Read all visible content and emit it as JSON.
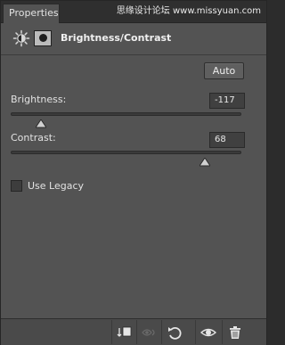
{
  "window": {
    "tab_label": "Properties",
    "watermark": "思缘设计论坛 www.missyuan.com"
  },
  "header": {
    "title": "Brightness/Contrast",
    "icons": [
      "brightness-contrast-icon",
      "layer-mask-icon"
    ]
  },
  "controls": {
    "auto_label": "Auto",
    "brightness": {
      "label": "Brightness:",
      "value": "-117",
      "slider_fraction": 0.13
    },
    "contrast": {
      "label": "Contrast:",
      "value": "68",
      "slider_fraction": 0.84
    },
    "use_legacy": {
      "label": "Use Legacy",
      "checked": false
    }
  },
  "toolbar": {
    "icons": [
      "clip-to-layer-icon",
      "view-previous-state-icon",
      "reset-icon",
      "visibility-eye-icon",
      "trash-icon"
    ]
  },
  "colors": {
    "panel": "#535353",
    "tab_bar": "#2f2f2f",
    "value_box": "#404040"
  }
}
